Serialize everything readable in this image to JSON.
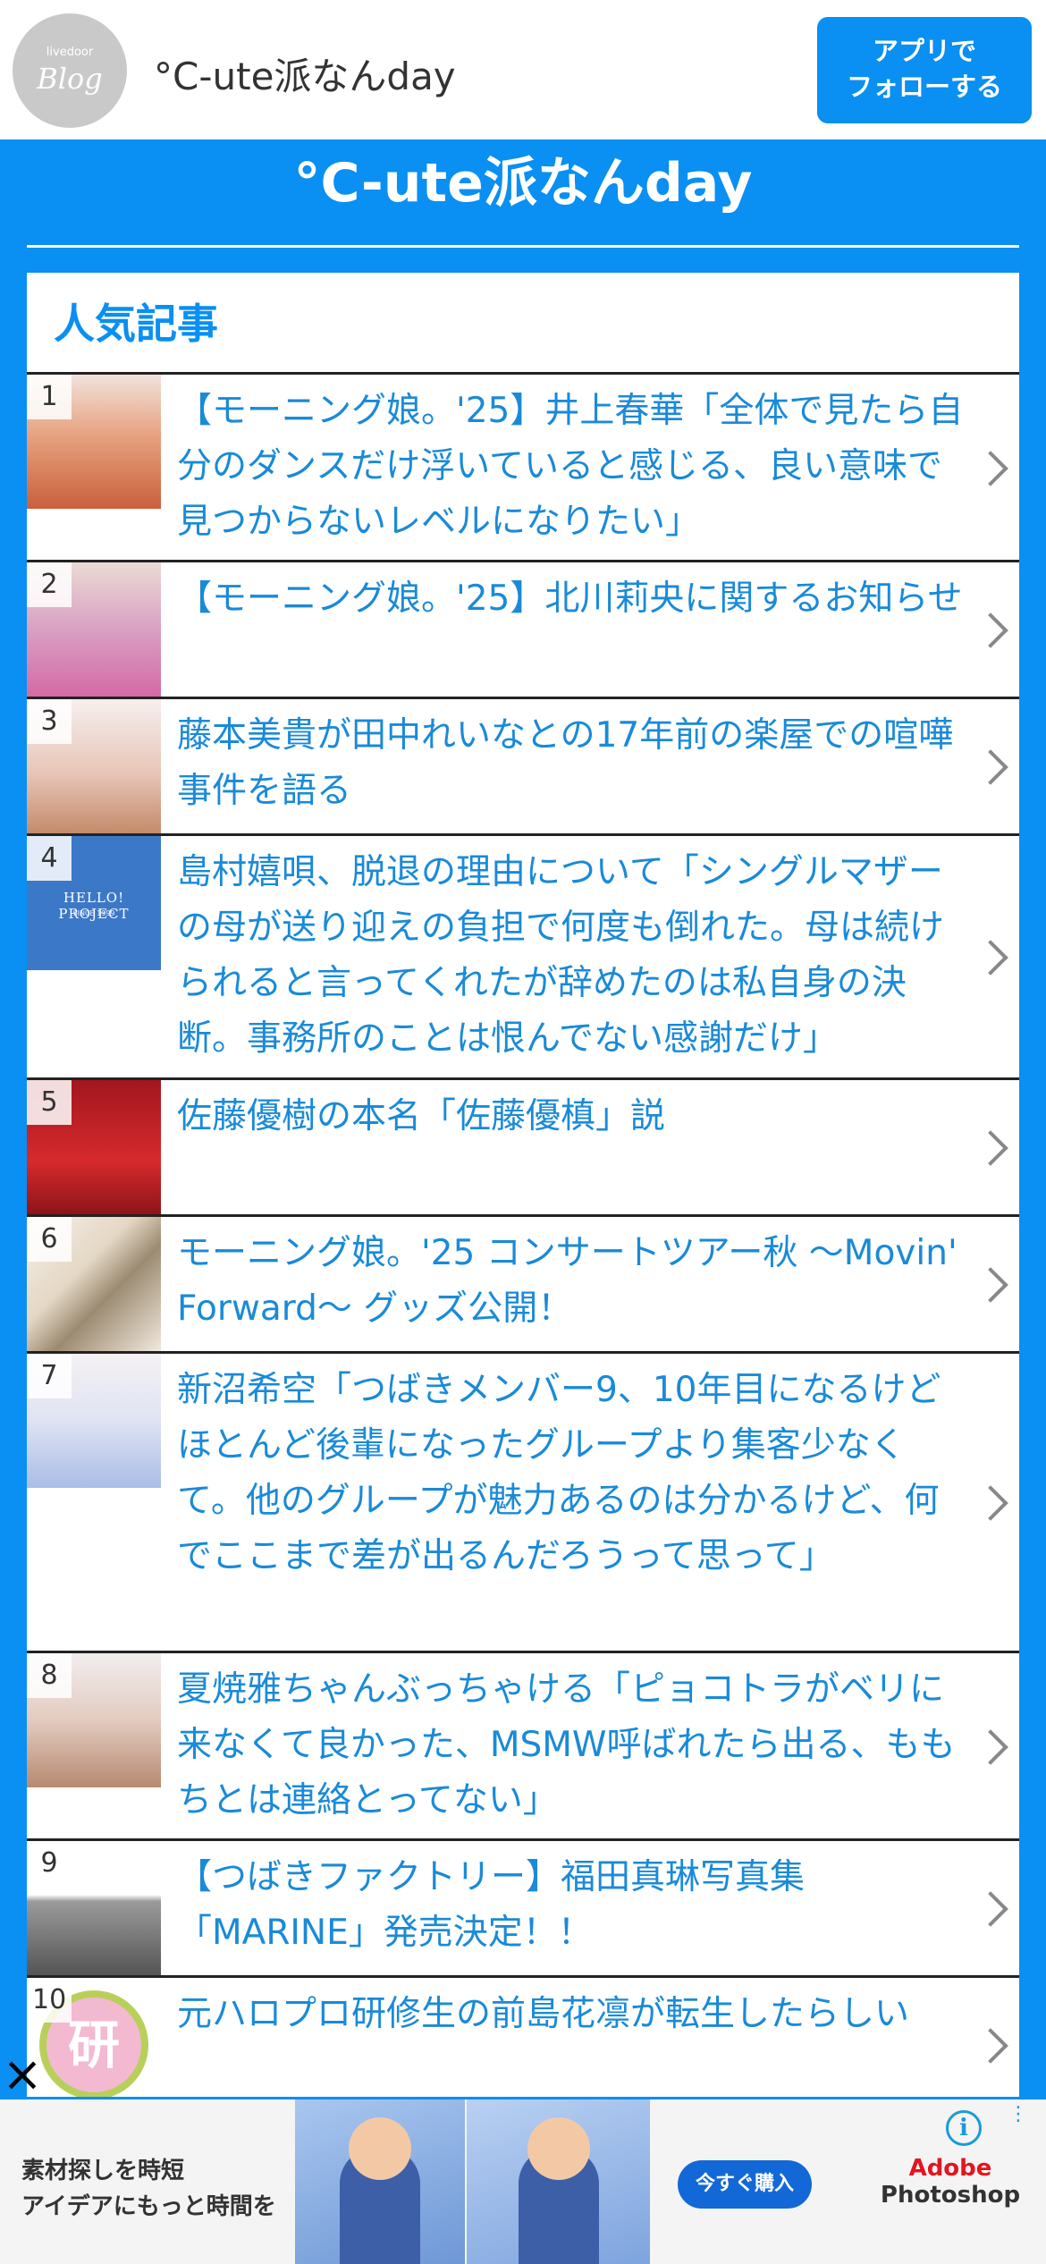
{
  "header": {
    "logo_small": "livedoor",
    "logo_big": "Blog",
    "blog_name": "°C-ute派なんday",
    "follow_line1": "アプリで",
    "follow_line2": "フォローする"
  },
  "site_title": "°C-ute派なんday",
  "popular": {
    "heading": "人気記事",
    "items": [
      {
        "rank": "1",
        "title": "【モーニング娘。'25】井上春華「全体で見たら自分のダンスだけ浮いていると感じる、良い意味で見つからないレベルになりたい」"
      },
      {
        "rank": "2",
        "title": "【モーニング娘。'25】北川莉央に関するお知らせ"
      },
      {
        "rank": "3",
        "title": "藤本美貴が田中れいなとの17年前の楽屋での喧嘩事件を語る"
      },
      {
        "rank": "4",
        "title": "島村嬉唄、脱退の理由について「シングルマザーの母が送り迎えの負担で何度も倒れた。母は続けられると言ってくれたが辞めたのは私自身の決断。事務所のことは恨んでない感謝だけ」"
      },
      {
        "rank": "5",
        "title": "佐藤優樹の本名「佐藤優槙」説"
      },
      {
        "rank": "6",
        "title": "モーニング娘。'25 コンサートツアー秋 ～Movin' Forward～ グッズ公開！"
      },
      {
        "rank": "7",
        "title": "新沼希空「つばきメンバー9、10年目になるけどほとんど後輩になったグループより集客少なくて。他のグループが魅力あるのは分かるけど、何でここまで差が出るんだろうって思って」"
      },
      {
        "rank": "8",
        "title": "夏焼雅ちゃんぶっちゃける「ピョコトラがベリに来なくて良かった、MSMW呼ばれたら出る、ももちとは連絡とってない」"
      },
      {
        "rank": "9",
        "title": "【つばきファクトリー】福田真琳写真集「MARINE」発売決定！！"
      },
      {
        "rank": "10",
        "title": "元ハロプロ研修生の前島花凛が転生したらしい"
      }
    ],
    "thumb4_text": "HELLO! PROJECT",
    "thumb4_sub": "SINCE 1999",
    "thumb10_text": "研"
  },
  "ad": {
    "close": "×",
    "line1": "素材探しを時短",
    "line2": "アイデアにもっと時間を",
    "buy": "今すぐ購入",
    "brand1": "Adobe",
    "brand2": "Photoshop",
    "info": "i",
    "dots": "⋮"
  },
  "colors": {
    "accent": "#0a8ff2",
    "link": "#1a8ad8"
  }
}
